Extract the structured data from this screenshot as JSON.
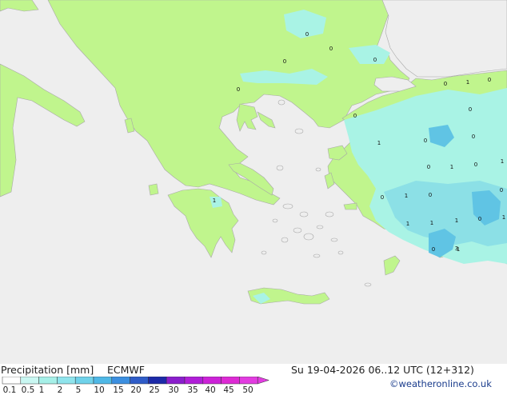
{
  "header": {
    "title": "Precipitation [mm]",
    "model": "ECMWF",
    "datetime": "Su 19-04-2026 06..12 UTC (12+312)",
    "credit": "©weatheronline.co.uk"
  },
  "colors": {
    "sea": "#eeeeee",
    "land": "#c0f58d",
    "coast": "#a8a8a8",
    "precip_light": "#a9f3e5",
    "precip_medium": "#8ce0e6",
    "precip_heavy": "#60c4e4"
  },
  "legend": {
    "ticks": [
      "0.1",
      "0.5",
      "1",
      "2",
      "5",
      "10",
      "15",
      "20",
      "25",
      "30",
      "35",
      "40",
      "45",
      "50"
    ],
    "colors": [
      "#ffffff",
      "#c9f7f2",
      "#a6f0e8",
      "#8fe4ec",
      "#6fd2ea",
      "#4fb8e6",
      "#3c8fe0",
      "#2f5cc8",
      "#1c2aa8",
      "#8a1ecc",
      "#b01ed8",
      "#cc22d8",
      "#dd2ad4",
      "#e23ce0"
    ]
  },
  "map_labels": [
    "0",
    "0",
    "0",
    "0",
    "1",
    "0",
    "1",
    "0",
    "0",
    "0",
    "1",
    "0",
    "0",
    "0",
    "1",
    "0",
    "0",
    "0",
    "1",
    "0",
    "1",
    "1",
    "1",
    "0",
    "1",
    "0",
    "1",
    "1",
    "3",
    "0"
  ]
}
